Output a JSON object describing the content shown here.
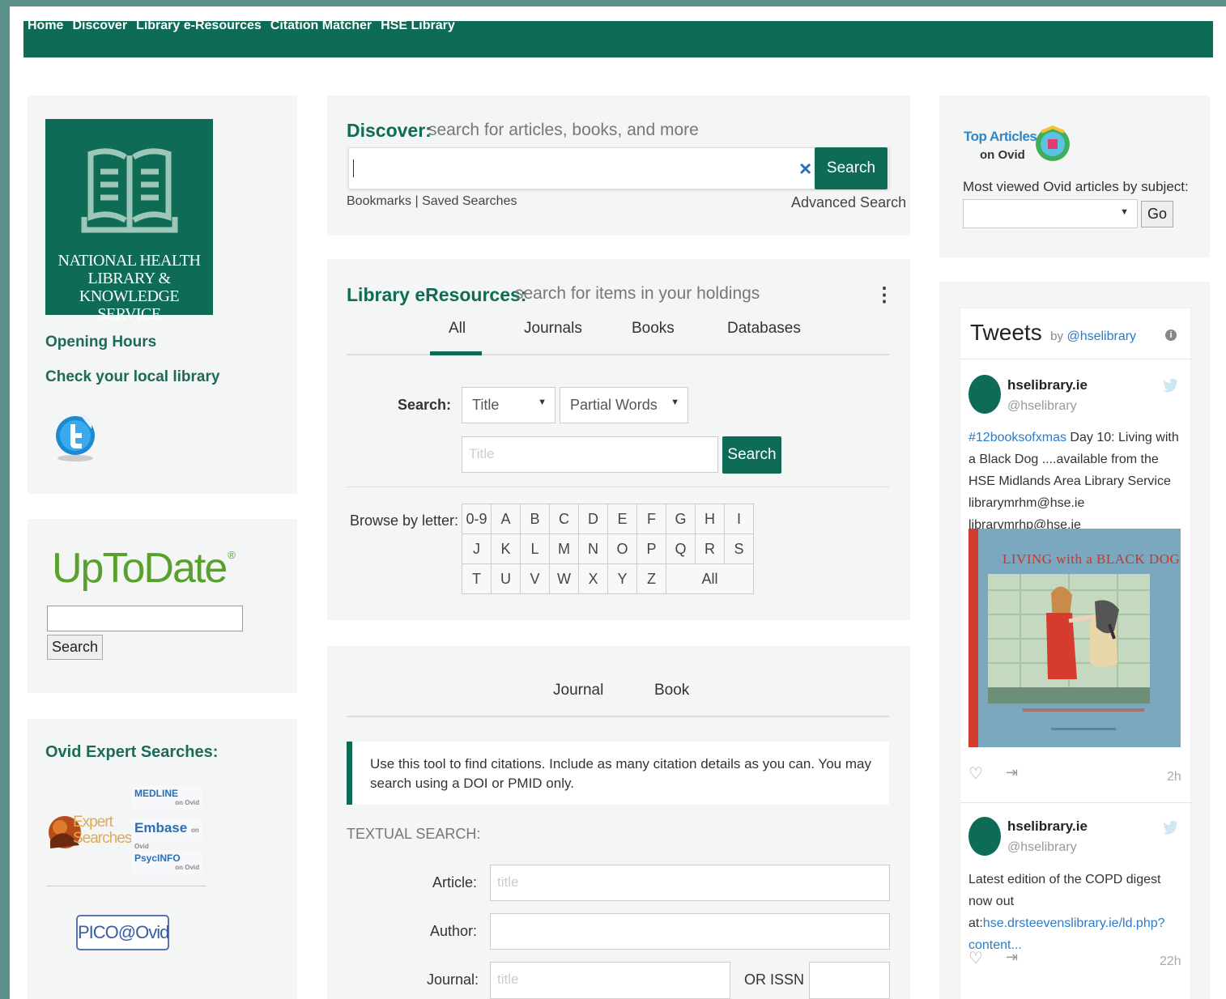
{
  "nav": {
    "items": [
      "Home",
      "Discover",
      "Library e-Resources",
      "Citation Matcher",
      "HSE Library"
    ]
  },
  "left": {
    "logo_lines": [
      "NATIONAL HEALTH",
      "LIBRARY & KNOWLEDGE",
      "SERVICE"
    ],
    "opening_hours": "Opening Hours",
    "local_library": "Check your local library",
    "uptodate_brand": "UpToDate",
    "uptodate_reg": "®",
    "uptodate_search": "Search",
    "ovid_title": "Ovid Expert Searches:",
    "expert_logo": "Expert Searches",
    "ovid_dbs": [
      "MEDLINE",
      "Embase",
      "PsycINFO"
    ],
    "ovid_suffix": "on Ovid",
    "pico": "PICO@Ovid"
  },
  "discover": {
    "title": "Discover:",
    "subtitle": "search for articles, books, and more",
    "search_button": "Search",
    "clear": "×",
    "bookmarks": "Bookmarks | Saved Searches",
    "advanced": "Advanced Search"
  },
  "eresources": {
    "title": "Library eResources:",
    "subtitle": "search for items in your holdings",
    "menu": "⋮",
    "tabs": [
      "All",
      "Journals",
      "Books",
      "Databases"
    ],
    "search_label": "Search:",
    "field_select": "Title",
    "match_select": "Partial Words",
    "placeholder": "Title",
    "search_button": "Search",
    "browse_label": "Browse by letter:",
    "letters_row1": [
      "0-9",
      "A",
      "B",
      "C",
      "D",
      "E",
      "F",
      "G",
      "H",
      "I"
    ],
    "letters_row2": [
      "J",
      "K",
      "L",
      "M",
      "N",
      "O",
      "P",
      "Q",
      "R",
      "S"
    ],
    "letters_row3": [
      "T",
      "U",
      "V",
      "W",
      "X",
      "Y",
      "Z"
    ],
    "letters_all": "All"
  },
  "citation": {
    "tabs": [
      "Journal",
      "Book"
    ],
    "note": "Use this tool to find citations. Include as many citation details as you can. You may search using a DOI or PMID only.",
    "textual_search": "TEXTUAL SEARCH:",
    "article_label": "Article:",
    "article_placeholder": "title",
    "author_label": "Author:",
    "journal_label": "Journal:",
    "journal_placeholder": "title",
    "issn_label": "OR ISSN"
  },
  "top_articles": {
    "title_line1": "Top Articles",
    "title_line2": "on Ovid",
    "subtitle": "Most viewed Ovid articles by subject:",
    "go": "Go"
  },
  "tweets": {
    "header": "Tweets",
    "by": "by",
    "handle_link": "@hselibrary",
    "items": [
      {
        "name": "hselibrary.ie",
        "handle": "@hselibrary",
        "hashtag": "#12booksofxmas",
        "text": "Day 10: Living with a Black Dog ....available from the HSE Midlands Area Library Service librarymrhm@hse.ie librarymrhp@hse.ie",
        "image_title": "LIVING with a BLACK DOG",
        "time": "2h"
      },
      {
        "name": "hselibrary.ie",
        "handle": "@hselibrary",
        "text": "Latest edition of the COPD digest now out at:",
        "link": "hse.drsteevenslibrary.ie/ld.php?content...",
        "time": "22h"
      }
    ]
  }
}
